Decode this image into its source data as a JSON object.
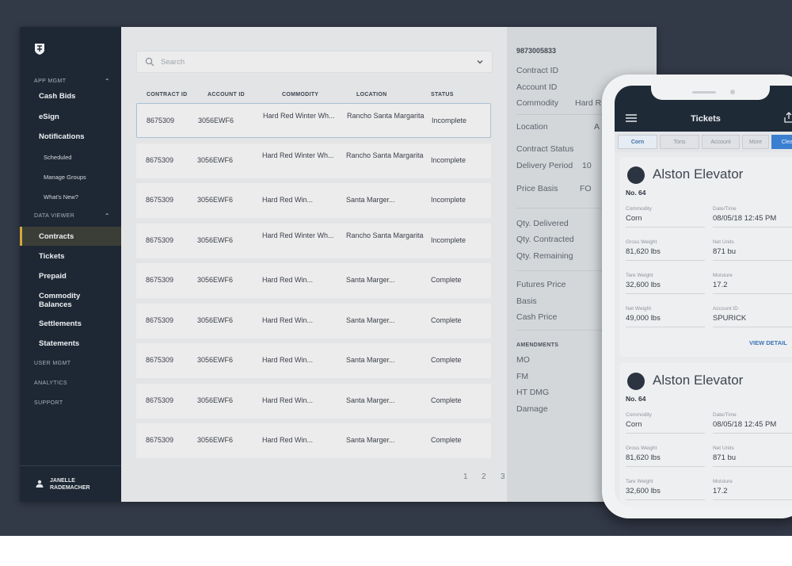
{
  "sidebar": {
    "sections": [
      {
        "label": "APP MGMT"
      },
      {
        "label": "DATA VIEWER"
      }
    ],
    "app_mgmt_items": [
      "Cash Bids",
      "eSign",
      "Notifications"
    ],
    "notification_subitems": [
      "Scheduled",
      "Manage Groups",
      "What's New?"
    ],
    "data_viewer_items": [
      "Contracts",
      "Tickets",
      "Prepaid",
      "Commodity Balances",
      "Settlements",
      "Statements"
    ],
    "bottom_items": [
      "USER MGMT",
      "ANALYTICS",
      "SUPPORT"
    ],
    "active_item": "Contracts",
    "user": "JANELLE RADEMACHER",
    "accent_color": "#d2a93b"
  },
  "search": {
    "placeholder": "Search"
  },
  "table": {
    "headers": [
      "CONTRACT ID",
      "ACCOUNT ID",
      "COMMODITY",
      "LOCATION",
      "STATUS"
    ],
    "rows": [
      [
        "8675309",
        "3056EWF6",
        "Hard Red Winter Wh...",
        "Rancho Santa Margarita",
        "Incomplete"
      ],
      [
        "8675309",
        "3056EWF6",
        "Hard Red Winter Wh...",
        "Rancho Santa Margarita",
        "Incomplete"
      ],
      [
        "8675309",
        "3056EWF6",
        "Hard Red Win...",
        "Santa Marger...",
        "Incomplete"
      ],
      [
        "8675309",
        "3056EWF6",
        "Hard Red Winter Wh...",
        "Rancho Santa Margarita",
        "Incomplete"
      ],
      [
        "8675309",
        "3056EWF6",
        "Hard Red Win...",
        "Santa Marger...",
        "Complete"
      ],
      [
        "8675309",
        "3056EWF6",
        "Hard Red Win...",
        "Santa Marger...",
        "Complete"
      ],
      [
        "8675309",
        "3056EWF6",
        "Hard Red Win...",
        "Santa Marger...",
        "Complete"
      ],
      [
        "8675309",
        "3056EWF6",
        "Hard Red Win...",
        "Santa Marger...",
        "Complete"
      ],
      [
        "8675309",
        "3056EWF6",
        "Hard Red Win...",
        "Santa Marger...",
        "Complete"
      ]
    ]
  },
  "pagination": [
    "1",
    "2",
    "3"
  ],
  "detail": {
    "id": "9873005833",
    "fields": [
      {
        "label": "Contract ID",
        "value": ""
      },
      {
        "label": "Account ID",
        "value": ""
      },
      {
        "label": "Commodity",
        "value": "Hard R"
      },
      {
        "label": "Location",
        "value": "A"
      },
      {
        "label": "Contract Status",
        "value": ""
      },
      {
        "label": "Delivery Period",
        "value": "10"
      },
      {
        "label": "Price Basis",
        "value": "FO"
      },
      {
        "label": "Qty. Delivered",
        "value": ""
      },
      {
        "label": "Qty. Contracted",
        "value": ""
      },
      {
        "label": "Qty. Remaining",
        "value": ""
      },
      {
        "label": "Futures Price",
        "value": ""
      },
      {
        "label": "Basis",
        "value": ""
      },
      {
        "label": "Cash Price",
        "value": ""
      }
    ],
    "amendments_heading": "AMENDMENTS",
    "amendments": [
      "MO",
      "FM",
      "HT DMG",
      "Damage"
    ]
  },
  "phone": {
    "title": "Tickets",
    "tabs": [
      "Corn",
      "Tons",
      "Account",
      "More",
      "Clea"
    ],
    "cards": [
      {
        "name": "Alston Elevator",
        "number": "No. 64",
        "fields": [
          {
            "label": "Commodity",
            "value": "Corn"
          },
          {
            "label": "Date/Time",
            "value": "08/05/18 12:45 PM"
          },
          {
            "label": "Gross Weight",
            "value": "81,620 lbs"
          },
          {
            "label": "Net Units",
            "value": "871 bu"
          },
          {
            "label": "Tare Weight",
            "value": "32,600 lbs"
          },
          {
            "label": "Moisture",
            "value": "17.2"
          },
          {
            "label": "Net Weight",
            "value": "49,000 lbs"
          },
          {
            "label": "Account ID",
            "value": "SPURICK"
          }
        ],
        "action": "VIEW DETAIL"
      },
      {
        "name": "Alston Elevator",
        "number": "No. 64",
        "fields": [
          {
            "label": "Commodity",
            "value": "Corn"
          },
          {
            "label": "Date/Time",
            "value": "08/05/18 12:45 PM"
          },
          {
            "label": "Gross Weight",
            "value": "81,620 lbs"
          },
          {
            "label": "Net Units",
            "value": "871 bu"
          },
          {
            "label": "Tare Weight",
            "value": "32,600 lbs"
          },
          {
            "label": "Moisture",
            "value": "17.2"
          }
        ]
      }
    ]
  }
}
